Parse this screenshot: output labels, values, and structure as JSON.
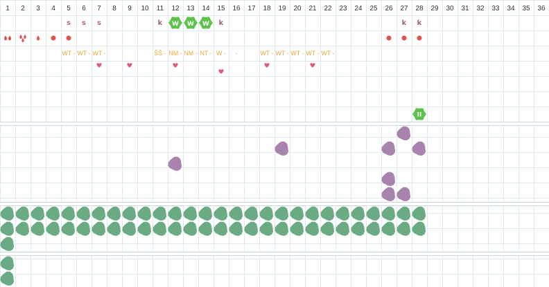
{
  "days": [
    "1",
    "2",
    "3",
    "4",
    "5",
    "6",
    "7",
    "8",
    "9",
    "10",
    "11",
    "12",
    "13",
    "14",
    "15",
    "16",
    "17",
    "18",
    "19",
    "20",
    "21",
    "22",
    "23",
    "24",
    "25",
    "26",
    "27",
    "28",
    "29",
    "30",
    "31",
    "32",
    "33",
    "34",
    "35",
    "36"
  ],
  "colors": {
    "grid": "#dce9ee",
    "red": "#e0524f",
    "s_letter": "#b56a88",
    "k_letter": "#9b6477",
    "heart": "#de5a7e",
    "wt": "#f0a93a",
    "bright_green": "#5cc24a",
    "purple": "#a883ad",
    "sage": "#6aab84"
  },
  "row_letters": [
    {
      "day": 5,
      "text": "s"
    },
    {
      "day": 6,
      "text": "s"
    },
    {
      "day": 7,
      "text": "s"
    },
    {
      "day": 11,
      "text": "k"
    },
    {
      "day": 15,
      "text": "k"
    },
    {
      "day": 27,
      "text": "k"
    },
    {
      "day": 28,
      "text": "k"
    }
  ],
  "row_w_badges": [
    {
      "day": 12,
      "text": "W"
    },
    {
      "day": 13,
      "text": "W"
    },
    {
      "day": 14,
      "text": "W"
    }
  ],
  "row_drops": [
    {
      "day": 1,
      "icon": "double-drop-icon"
    },
    {
      "day": 2,
      "icon": "triple-drop-icon"
    },
    {
      "day": 3,
      "icon": "drop-icon"
    },
    {
      "day": 4,
      "icon": "dot-icon"
    },
    {
      "day": 5,
      "icon": "dot-icon"
    },
    {
      "day": 26,
      "icon": "dot-icon"
    },
    {
      "day": 27,
      "icon": "dot-icon"
    },
    {
      "day": 28,
      "icon": "dot-icon"
    }
  ],
  "row_codes": [
    {
      "day": 5,
      "text": "WT -"
    },
    {
      "day": 6,
      "text": "WT -"
    },
    {
      "day": 7,
      "text": "WT -"
    },
    {
      "day": 11,
      "text": "ŠŠ -"
    },
    {
      "day": 12,
      "text": "NM -"
    },
    {
      "day": 13,
      "text": "NM -"
    },
    {
      "day": 14,
      "text": "NT -"
    },
    {
      "day": 15,
      "text": "W -"
    },
    {
      "day": 16,
      "text": "-"
    },
    {
      "day": 18,
      "text": "WT -"
    },
    {
      "day": 19,
      "text": "WT -"
    },
    {
      "day": 20,
      "text": "WT -"
    },
    {
      "day": 21,
      "text": "WT -"
    },
    {
      "day": 22,
      "text": "WT -"
    }
  ],
  "hearts": [
    {
      "day": 7,
      "row": 4
    },
    {
      "day": 9,
      "row": 4
    },
    {
      "day": 12,
      "row": 4
    },
    {
      "day": 15,
      "row": 5
    },
    {
      "day": 18,
      "row": 4
    },
    {
      "day": 21,
      "row": 4
    }
  ],
  "green_badge": {
    "day": 28,
    "row": 7,
    "text": "II"
  },
  "purple_marks": [
    {
      "day": 27,
      "row": 9
    },
    {
      "day": 19,
      "row": 10
    },
    {
      "day": 26,
      "row": 10
    },
    {
      "day": 28,
      "row": 10
    },
    {
      "day": 12,
      "row": 11
    },
    {
      "day": 26,
      "row": 12
    },
    {
      "day": 26,
      "row": 13
    },
    {
      "day": 27,
      "row": 13
    }
  ],
  "sage_rows": [
    {
      "row": 14,
      "from": 1,
      "to": 28
    },
    {
      "row": 15,
      "from": 1,
      "to": 28
    },
    {
      "row": 16,
      "from": 1,
      "to": 1
    },
    {
      "row": 17,
      "from": 1,
      "to": 1
    },
    {
      "row": 18,
      "from": 1,
      "to": 1
    }
  ]
}
